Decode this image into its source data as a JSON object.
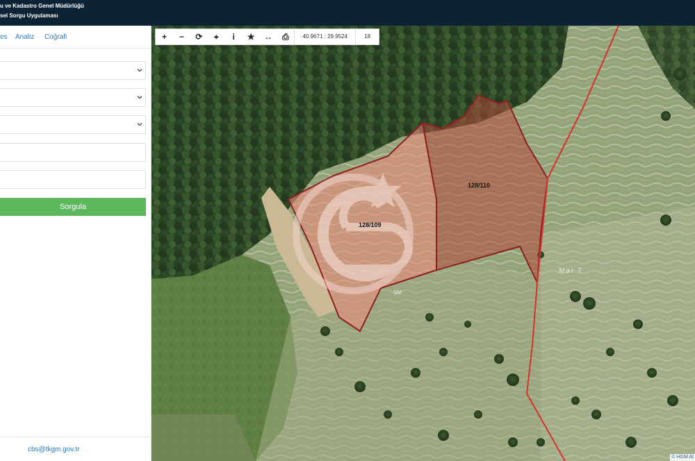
{
  "header": {
    "line1": "u ve Kadastro Genel Müdürlüğü",
    "line2": "sel Sorgu Uygulaması"
  },
  "sidebar": {
    "tabs": [
      "es",
      "Analiz",
      "Coğrafi"
    ],
    "submit_label": "Sorgula",
    "footer_email": "cbs@tkgm.gov.tr"
  },
  "toolbar": {
    "buttons": [
      "zoom-in",
      "zoom-out",
      "refresh",
      "locate",
      "info",
      "favorite",
      "measure",
      "print"
    ],
    "coordinates": "40.9671 : 29.9524",
    "zoom_level": "18"
  },
  "map": {
    "parcels": [
      {
        "label": "128/109",
        "color": "#f08a7a"
      },
      {
        "label": "128/110",
        "color": "#b44a3a"
      }
    ],
    "road_label": "Mal T",
    "attribution": "© HGM At",
    "watermark": "CB",
    "watermark_sub": "SM"
  }
}
